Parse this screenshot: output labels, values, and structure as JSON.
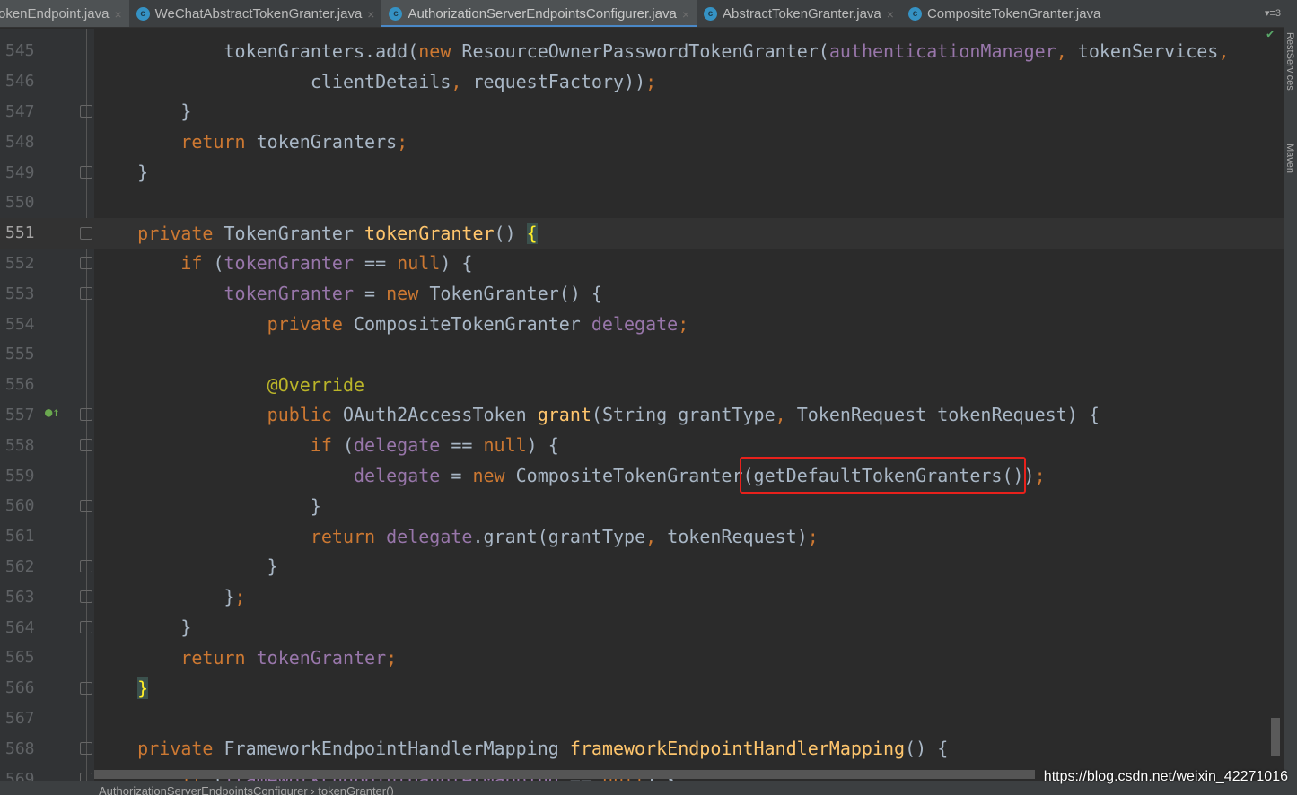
{
  "tabs": [
    {
      "label": "okenEndpoint.java",
      "icon": "none",
      "active": false,
      "first": true
    },
    {
      "label": "WeChatAbstractTokenGranter.java",
      "icon": "class-icon",
      "active": false
    },
    {
      "label": "AuthorizationServerEndpointsConfigurer.java",
      "icon": "class-icon",
      "active": true
    },
    {
      "label": "AbstractTokenGranter.java",
      "icon": "class-icon",
      "active": false
    },
    {
      "label": "CompositeTokenGranter.java",
      "icon": "class-icon",
      "active": false,
      "noclose": true
    }
  ],
  "tab_overflow": "▾≡3",
  "right_tools": [
    "RestServices",
    "Maven"
  ],
  "breadcrumb": "AuthorizationServerEndpointsConfigurer  ›  tokenGranter()",
  "watermark": "https://blog.csdn.net/weixin_42271016",
  "current_line": 551,
  "colors": {
    "keyword": "#cc7832",
    "field": "#9876aa",
    "method": "#ffc66d",
    "annotation": "#bbb529",
    "text": "#a9b7c6",
    "highlight_box": "#e8211c"
  },
  "lines": [
    {
      "n": 545,
      "t": [
        [
          "            ",
          "d"
        ],
        [
          "tokenGranters.add(",
          "d"
        ],
        [
          "new ",
          "k"
        ],
        [
          "ResourceOwnerPasswordTokenGranter(",
          "d"
        ],
        [
          "authenticationManager",
          "f"
        ],
        [
          ", ",
          "k"
        ],
        [
          "tokenServices",
          "d"
        ],
        [
          ",",
          "k"
        ]
      ]
    },
    {
      "n": 546,
      "t": [
        [
          "                    clientDetails",
          "d"
        ],
        [
          ", ",
          "k"
        ],
        [
          "requestFactory))",
          "d"
        ],
        [
          ";",
          "k"
        ]
      ]
    },
    {
      "n": 547,
      "fold": true,
      "t": [
        [
          "        }",
          "d"
        ]
      ]
    },
    {
      "n": 548,
      "t": [
        [
          "        ",
          "d"
        ],
        [
          "return ",
          "k"
        ],
        [
          "tokenGranters",
          "d"
        ],
        [
          ";",
          "k"
        ]
      ]
    },
    {
      "n": 549,
      "fold": true,
      "t": [
        [
          "    }",
          "d"
        ]
      ]
    },
    {
      "n": 550,
      "t": []
    },
    {
      "n": 551,
      "fold": true,
      "t": [
        [
          "    ",
          "d"
        ],
        [
          "private ",
          "k"
        ],
        [
          "TokenGranter ",
          "d"
        ],
        [
          "tokenGranter",
          "m"
        ],
        [
          "() ",
          "d"
        ],
        [
          "{",
          "brace"
        ]
      ]
    },
    {
      "n": 552,
      "fold": true,
      "t": [
        [
          "        ",
          "d"
        ],
        [
          "if ",
          "k"
        ],
        [
          "(",
          "d"
        ],
        [
          "tokenGranter ",
          "f"
        ],
        [
          "== ",
          "d"
        ],
        [
          "null",
          "k"
        ],
        [
          ") {",
          "d"
        ]
      ]
    },
    {
      "n": 553,
      "fold": true,
      "t": [
        [
          "            ",
          "d"
        ],
        [
          "tokenGranter ",
          "f"
        ],
        [
          "= ",
          "d"
        ],
        [
          "new ",
          "k"
        ],
        [
          "TokenGranter() {",
          "d"
        ]
      ]
    },
    {
      "n": 554,
      "t": [
        [
          "                ",
          "d"
        ],
        [
          "private ",
          "k"
        ],
        [
          "CompositeTokenGranter ",
          "d"
        ],
        [
          "delegate",
          "f"
        ],
        [
          ";",
          "k"
        ]
      ]
    },
    {
      "n": 555,
      "t": []
    },
    {
      "n": 556,
      "t": [
        [
          "                ",
          "d"
        ],
        [
          "@Override",
          "a"
        ]
      ]
    },
    {
      "n": 557,
      "fold": true,
      "t": [
        [
          "                ",
          "d"
        ],
        [
          "public ",
          "k"
        ],
        [
          "OAuth2AccessToken ",
          "d"
        ],
        [
          "grant",
          "m"
        ],
        [
          "(String grantType",
          "d"
        ],
        [
          ", ",
          "k"
        ],
        [
          "TokenRequest tokenRequest) {",
          "d"
        ]
      ]
    },
    {
      "n": 558,
      "fold": true,
      "t": [
        [
          "                    ",
          "d"
        ],
        [
          "if ",
          "k"
        ],
        [
          "(",
          "d"
        ],
        [
          "delegate ",
          "f"
        ],
        [
          "== ",
          "d"
        ],
        [
          "null",
          "k"
        ],
        [
          ") {",
          "d"
        ]
      ]
    },
    {
      "n": 559,
      "t": [
        [
          "                        ",
          "d"
        ],
        [
          "delegate ",
          "f"
        ],
        [
          "= ",
          "d"
        ],
        [
          "new ",
          "k"
        ],
        [
          "CompositeTokenGranter(getDefaultTokenGranters())",
          "d"
        ],
        [
          ";",
          "k"
        ]
      ]
    },
    {
      "n": 560,
      "fold": true,
      "t": [
        [
          "                    }",
          "d"
        ]
      ]
    },
    {
      "n": 561,
      "t": [
        [
          "                    ",
          "d"
        ],
        [
          "return ",
          "k"
        ],
        [
          "delegate",
          "f"
        ],
        [
          ".grant(grantType",
          "d"
        ],
        [
          ", ",
          "k"
        ],
        [
          "tokenRequest)",
          "d"
        ],
        [
          ";",
          "k"
        ]
      ]
    },
    {
      "n": 562,
      "fold": true,
      "t": [
        [
          "                }",
          "d"
        ]
      ]
    },
    {
      "n": 563,
      "fold": true,
      "t": [
        [
          "            }",
          "d"
        ],
        [
          ";",
          "k"
        ]
      ]
    },
    {
      "n": 564,
      "fold": true,
      "t": [
        [
          "        }",
          "d"
        ]
      ]
    },
    {
      "n": 565,
      "t": [
        [
          "        ",
          "d"
        ],
        [
          "return ",
          "k"
        ],
        [
          "tokenGranter",
          "f"
        ],
        [
          ";",
          "k"
        ]
      ]
    },
    {
      "n": 566,
      "fold": true,
      "t": [
        [
          "    ",
          "d"
        ],
        [
          "}",
          "brace"
        ]
      ]
    },
    {
      "n": 567,
      "t": []
    },
    {
      "n": 568,
      "fold": true,
      "t": [
        [
          "    ",
          "d"
        ],
        [
          "private ",
          "k"
        ],
        [
          "FrameworkEndpointHandlerMapping ",
          "d"
        ],
        [
          "frameworkEndpointHandlerMapping",
          "m"
        ],
        [
          "() {",
          "d"
        ]
      ]
    },
    {
      "n": 569,
      "fold": true,
      "t": [
        [
          "        ",
          "d"
        ],
        [
          "if ",
          "k"
        ],
        [
          "(",
          "d"
        ],
        [
          "frameworkEndpointHandlerMapping ",
          "f"
        ],
        [
          "== ",
          "d"
        ],
        [
          "null",
          "k"
        ],
        [
          ") {",
          "d"
        ]
      ]
    }
  ]
}
